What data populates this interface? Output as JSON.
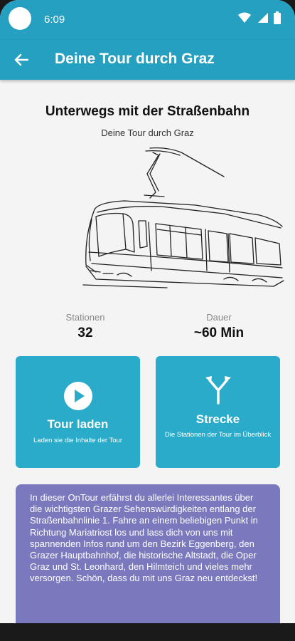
{
  "status_bar": {
    "time": "6:09"
  },
  "app_bar": {
    "title": "Deine Tour durch Graz"
  },
  "tour": {
    "heading": "Unterwegs mit der Straßenbahn",
    "subheading": "Deine Tour durch Graz",
    "stats": [
      {
        "label": "Stationen",
        "value": "32"
      },
      {
        "label": "Dauer",
        "value": "~60 Min"
      }
    ]
  },
  "cards": {
    "load": {
      "title": "Tour laden",
      "description": "Laden sie die Inhalte der Tour",
      "icon": "play-circle-icon"
    },
    "route": {
      "title": "Strecke",
      "description": "Die Stationen der Tour im Überblick",
      "icon": "route-split-icon"
    }
  },
  "info_text": "In dieser OnTour erfährst du allerlei Interessantes über die wichtigsten Grazer Sehenswürdigkeiten entlang der Straßenbahnlinie 1. Fahre an einem beliebigen Punkt in Richtung Mariatriost los und lass dich von uns mit spannenden Infos rund um den Bezirk Eggenberg, den Grazer Hauptbahnhof, die historische Altstadt, die Oper Graz und St. Leonhard, den Hilmteich und vieles mehr versorgen. Schön, dass du mit uns Graz neu entdeckst!",
  "colors": {
    "primary": "#26a0c0",
    "card": "#2aabc9",
    "info_box": "#7a79bd"
  }
}
